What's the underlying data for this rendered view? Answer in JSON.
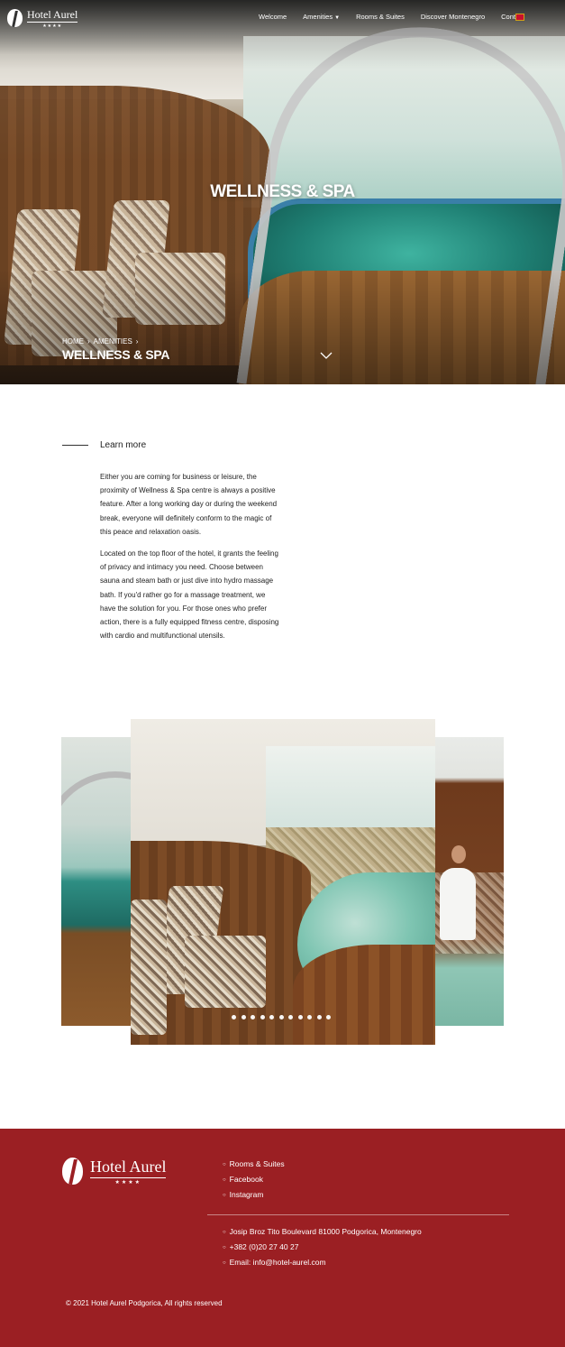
{
  "nav": {
    "logo_text": "Hotel Aurel",
    "logo_stars": "★★★★",
    "menu": [
      "Welcome",
      "Amenities",
      "Rooms & Suites",
      "Discover Montenegro",
      "Contact"
    ],
    "amenities_caret": "▼",
    "flag_icon": "montenegro-flag-icon"
  },
  "hero": {
    "title": "WELLNESS & SPA",
    "breadcrumb": [
      "HOME",
      "AMENITIES"
    ],
    "breadcrumb_sep": "›",
    "current": "WELLNESS & SPA",
    "scroll_icon": "chevron-down-icon"
  },
  "content": {
    "learn_more": "Learn more",
    "paragraph_1": "Either you are coming for business or leisure, the proximity of Wellness & Spa centre is always a positive feature. After a long working day or during the weekend break, everyone will definitely conform to the magic of this peace and relaxation oasis.",
    "paragraph_2": "Located on the top floor of the hotel, it grants the feeling of privacy and intimacy you need. Choose between sauna and steam bath or just dive into hydro massage bath. If you'd rather go for a massage treatment, we have the solution for you. For those ones who prefer action, there is a fully equipped fitness centre, disposing with cardio and multifunctional utensils."
  },
  "carousel": {
    "dot_count": 11
  },
  "footer": {
    "logo_text": "Hotel Aurel",
    "logo_stars": "★★★★",
    "links": [
      "Rooms & Suites",
      "Facebook",
      "Instagram"
    ],
    "contact": [
      "Josip Broz Tito Boulevard 81000 Podgorica, Montenegro",
      "+382 (0)20 27 40 27",
      "Email: info@hotel-aurel.com"
    ],
    "copyright": "© 2021 Hotel Aurel Podgorica, All rights reserved",
    "background": "#9b1f23"
  }
}
